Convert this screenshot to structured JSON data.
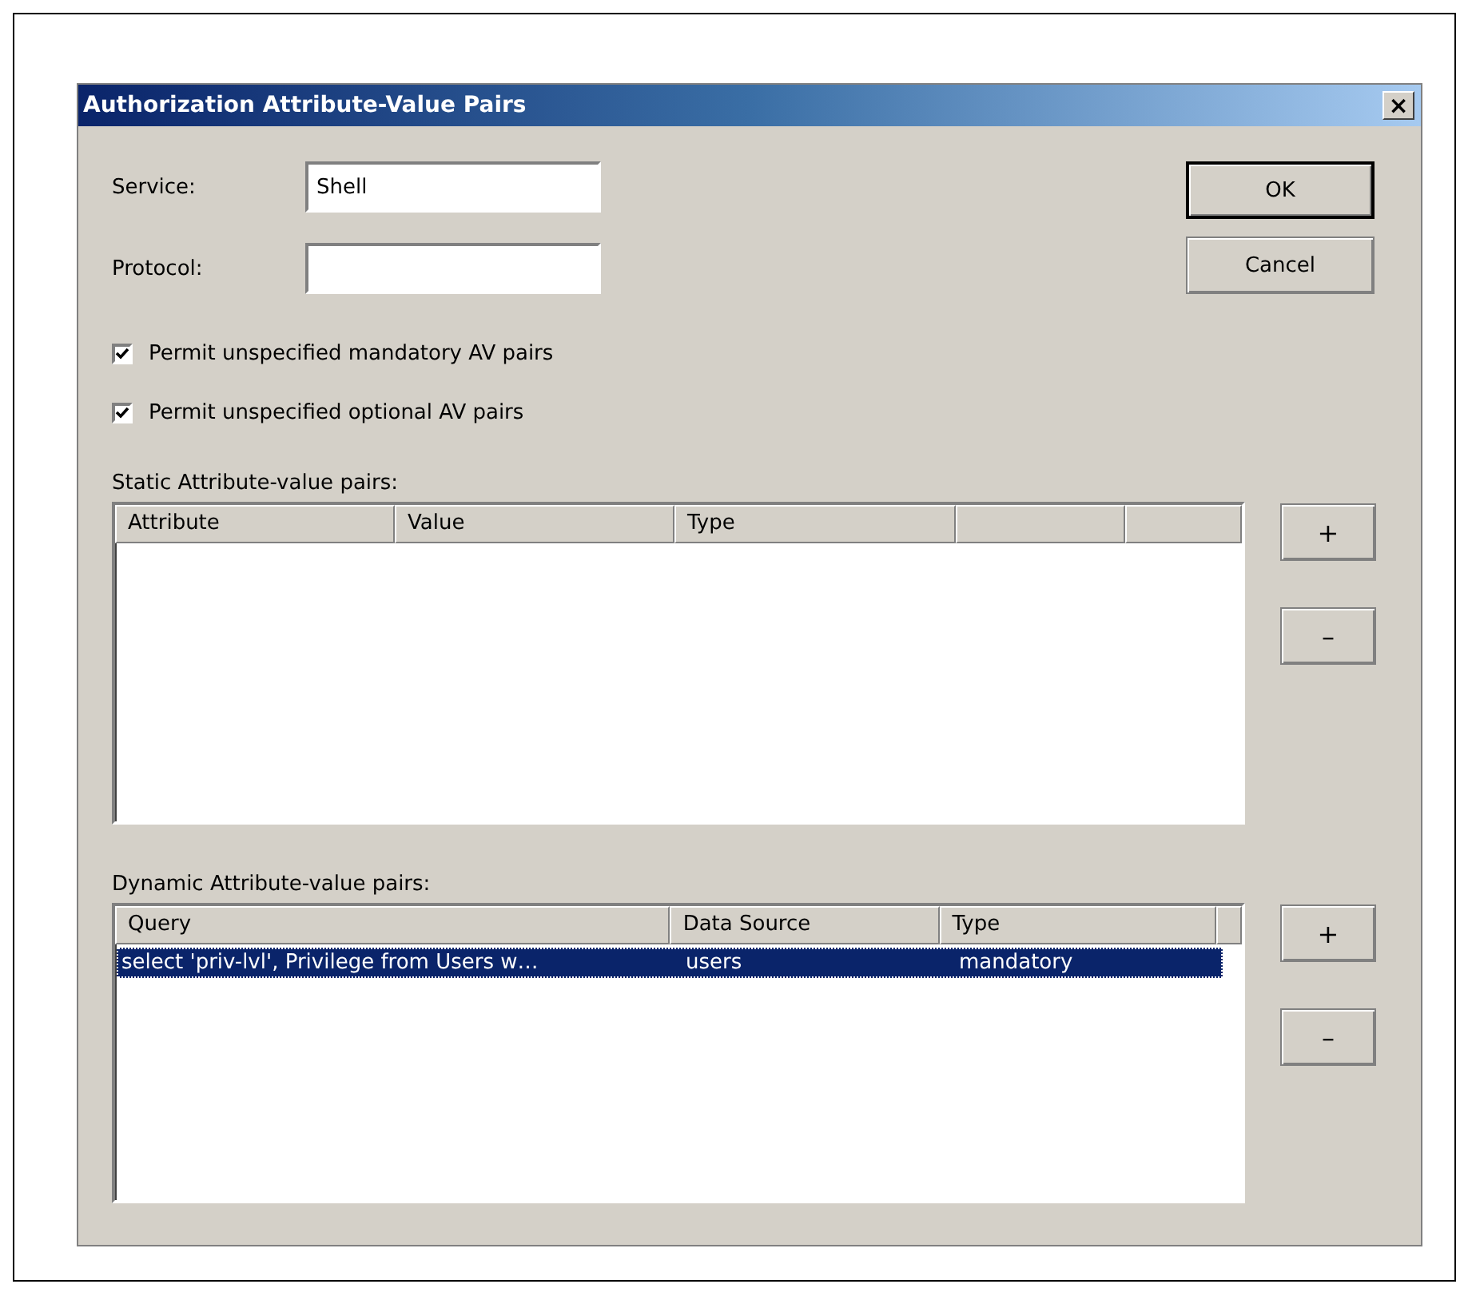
{
  "window": {
    "title": "Authorization Attribute-Value Pairs",
    "close": "×"
  },
  "fields": [
    {
      "label": "Service:",
      "value": "Shell"
    },
    {
      "label": "Protocol:"
    }
  ],
  "buttons": [
    "OK",
    "Cancel"
  ],
  "checkboxes": [
    {
      "label": "Permit unspecified mandatory AV pairs",
      "checked": true
    },
    {
      "label": "Permit unspecified optional AV pairs",
      "checked": true
    }
  ],
  "static_pairs": {
    "label": "Static Attribute-value pairs:",
    "columns": [
      {
        "kind": "text",
        "label": "Attribute"
      },
      {
        "kind": "text",
        "label": "Value"
      },
      {
        "kind": "text",
        "label": "Type"
      },
      {
        "kind": "blank"
      },
      {
        "kind": "blank"
      }
    ],
    "buttons": [
      "+",
      "–"
    ]
  },
  "dynamic_pairs": {
    "label": "Dynamic Attribute-value pairs:",
    "columns": [
      {
        "kind": "text",
        "label": "Query"
      },
      {
        "kind": "text",
        "label": "Data Source"
      },
      {
        "kind": "text",
        "label": "Type"
      },
      {
        "kind": "blank"
      }
    ],
    "rows": [
      {
        "cells": [
          "select 'priv-lvl', Privilege from Users w…",
          "users",
          "mandatory"
        ],
        "selected": true
      }
    ],
    "buttons": [
      "+",
      "–"
    ]
  }
}
